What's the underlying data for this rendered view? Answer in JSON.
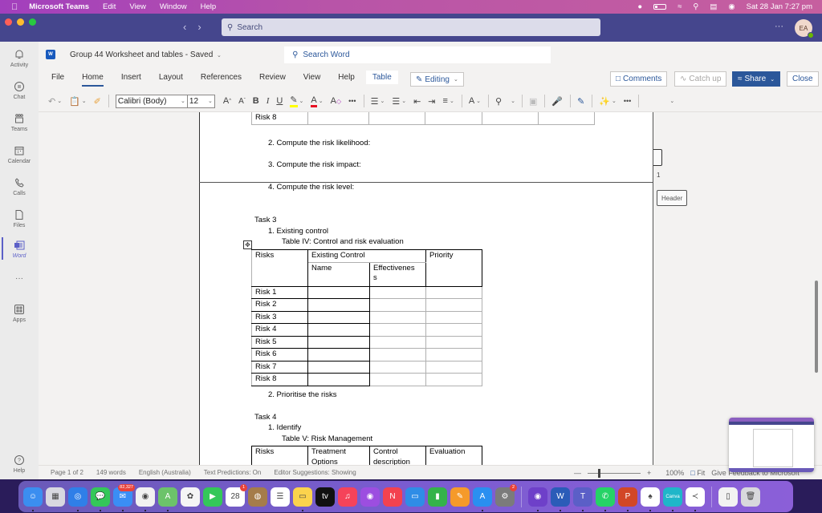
{
  "menubar": {
    "app_name": "Microsoft Teams",
    "items": [
      "Edit",
      "View",
      "Window",
      "Help"
    ],
    "clock": "Sat 28 Jan  7:27 pm"
  },
  "teams": {
    "search_placeholder": "Search",
    "more": "···",
    "avatar_initials": "EA",
    "rail": [
      {
        "label": "Activity",
        "icon": "bell-icon"
      },
      {
        "label": "Chat",
        "icon": "chat-icon"
      },
      {
        "label": "Teams",
        "icon": "teams-icon"
      },
      {
        "label": "Calendar",
        "icon": "calendar-icon"
      },
      {
        "label": "Calls",
        "icon": "phone-icon"
      },
      {
        "label": "Files",
        "icon": "file-icon"
      },
      {
        "label": "Word",
        "icon": "word-icon",
        "active": true
      },
      {
        "label": "···",
        "icon": "more-icon"
      },
      {
        "label": "Apps",
        "icon": "apps-icon"
      },
      {
        "label": "Help",
        "icon": "help-icon"
      }
    ]
  },
  "word": {
    "doc_title": "Group 44 Worksheet and tables  -  Saved",
    "search_placeholder": "Search Word",
    "tabs": [
      "File",
      "Home",
      "Insert",
      "Layout",
      "References",
      "Review",
      "View",
      "Help",
      "Table"
    ],
    "active_tab": "Home",
    "editing_label": "Editing",
    "comments_label": "Comments",
    "catchup_label": "Catch up",
    "share_label": "Share",
    "close_label": "Close",
    "font_name": "Calibri (Body)",
    "font_size": "12",
    "colors": {
      "accent": "#2b579a",
      "highlight": "#ffff00",
      "font_color": "#e81123"
    }
  },
  "document": {
    "prev_table_last_row": "Risk 8",
    "steps_task2": [
      "2.   Compute the risk likelihood:",
      "3.   Compute the risk impact:",
      "4.   Compute the risk level:"
    ],
    "task3": {
      "heading": "Task 3",
      "item1": "1.   Existing control",
      "caption": "Table IV: Control and risk evaluation",
      "headers": {
        "risks": "Risks",
        "existing": "Existing Control",
        "priority": "Priority",
        "name": "Name",
        "effectiveness_a": "Effectivenes",
        "effectiveness_b": "s"
      },
      "rows": [
        "Risk 1",
        "Risk 2",
        "Risk 3",
        "Risk 4",
        "Risk 5",
        "Risk 6",
        "Risk 7",
        "Risk 8"
      ],
      "item2": "2.   Prioritise the risks"
    },
    "task4": {
      "heading": "Task 4",
      "item1": "1.   Identify",
      "caption": "Table V: Risk Management",
      "headers": [
        "Risks",
        "Treatment Options",
        "Control description",
        "Evaluation"
      ]
    },
    "page_number": "1",
    "header_tag": "Header"
  },
  "statusbar": {
    "page": "Page 1 of 2",
    "words": "149 words",
    "language": "English (Australia)",
    "predictions": "Text Predictions: On",
    "editor": "Editor Suggestions: Showing",
    "zoom": "100%",
    "zoom_fraction": 0.2,
    "fit": "Fit",
    "feedback": "Give Feedback to Microsoft"
  },
  "dock": {
    "apps": [
      {
        "name": "Finder",
        "color": "#3b8ef0",
        "glyph": "☺",
        "running": true
      },
      {
        "name": "Launchpad",
        "color": "#d8d8e0",
        "glyph": "▦"
      },
      {
        "name": "Safari",
        "color": "#2f7fe8",
        "glyph": "◎",
        "running": true
      },
      {
        "name": "Messages",
        "color": "#34c759",
        "glyph": "💬",
        "running": true
      },
      {
        "name": "Mail",
        "color": "#3a8ef5",
        "glyph": "✉",
        "badge": "82,327",
        "running": true
      },
      {
        "name": "Chrome",
        "color": "#f1f1f1",
        "glyph": "◉",
        "running": true
      },
      {
        "name": "Maps",
        "color": "#6cc36a",
        "glyph": "A",
        "running": true
      },
      {
        "name": "Photos",
        "color": "#f5f5f5",
        "glyph": "✿"
      },
      {
        "name": "FaceTime",
        "color": "#34c759",
        "glyph": "▶"
      },
      {
        "name": "Calendar",
        "color": "#ffffff",
        "glyph": "28",
        "badge": "1"
      },
      {
        "name": "Contacts",
        "color": "#a57c4a",
        "glyph": "◍"
      },
      {
        "name": "Reminders",
        "color": "#ffffff",
        "glyph": "☰"
      },
      {
        "name": "Notes",
        "color": "#fbd34d",
        "glyph": "▭",
        "running": true
      },
      {
        "name": "TV",
        "color": "#111111",
        "glyph": "tv"
      },
      {
        "name": "Music",
        "color": "#f5435a",
        "glyph": "♫"
      },
      {
        "name": "Podcasts",
        "color": "#9c4ee0",
        "glyph": "◉"
      },
      {
        "name": "News",
        "color": "#f3424f",
        "glyph": "N"
      },
      {
        "name": "Keynote",
        "color": "#2f8de6",
        "glyph": "▭"
      },
      {
        "name": "Numbers",
        "color": "#34b34a",
        "glyph": "▮"
      },
      {
        "name": "Pages",
        "color": "#f59a2a",
        "glyph": "✎"
      },
      {
        "name": "App Store",
        "color": "#2a8ff0",
        "glyph": "A",
        "running": true
      },
      {
        "name": "System Preferences",
        "color": "#7b7b7b",
        "glyph": "⚙",
        "badge": "2"
      },
      {
        "name": "GitHub Desktop",
        "color": "#6e40c9",
        "glyph": "◉",
        "running": true
      },
      {
        "name": "Microsoft Word",
        "color": "#2b5cb8",
        "glyph": "W",
        "running": true
      },
      {
        "name": "Microsoft Teams",
        "color": "#5b5fc7",
        "glyph": "T",
        "running": true
      },
      {
        "name": "WhatsApp",
        "color": "#25d366",
        "glyph": "✆",
        "running": true
      },
      {
        "name": "PowerPoint",
        "color": "#d24726",
        "glyph": "P",
        "running": true
      },
      {
        "name": "MongoDB Compass",
        "color": "#ffffff",
        "glyph": "♠",
        "running": true
      },
      {
        "name": "Canva",
        "color": "#1fb6c9",
        "glyph": "Canva",
        "running": true
      },
      {
        "name": "VS Code",
        "color": "#ffffff",
        "glyph": "≺",
        "running": true
      },
      {
        "name": "Document",
        "color": "#f2f2f2",
        "glyph": "▯"
      },
      {
        "name": "Trash",
        "color": "#d8d8dc",
        "glyph": "🗑"
      }
    ]
  }
}
